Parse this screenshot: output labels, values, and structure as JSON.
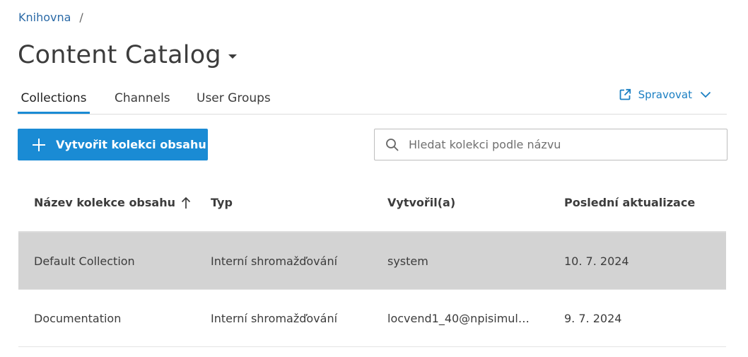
{
  "breadcrumb": {
    "link": "Knihovna",
    "separator": "/"
  },
  "page": {
    "title": "Content Catalog"
  },
  "tabs": [
    {
      "label": "Collections",
      "active": true
    },
    {
      "label": "Channels",
      "active": false
    },
    {
      "label": "User Groups",
      "active": false
    }
  ],
  "manage": {
    "label": "Spravovat",
    "icon": "external-link-icon"
  },
  "create_button": {
    "label": "Vytvořit kolekci obsahu",
    "icon": "plus-icon"
  },
  "search": {
    "placeholder": "Hledat kolekci podle názvu",
    "value": ""
  },
  "table": {
    "columns": [
      "Název kolekce obsahu",
      "Typ",
      "Vytvořil(a)",
      "Poslední aktualizace"
    ],
    "sort_icon": "arrow-up-icon",
    "rows": [
      {
        "name": "Default Collection",
        "type": "Interní shromažďování",
        "created_by": "system",
        "updated": "10. 7. 2024",
        "selected": true
      },
      {
        "name": "Documentation",
        "type": "Interní shromažďování",
        "created_by": "locvend1_40@npisimul…",
        "updated": "9. 7. 2024",
        "selected": false
      }
    ]
  },
  "colors": {
    "accent": "#1a8bd4",
    "link": "#2b6aa7",
    "selected_row": "#d3d3d3"
  }
}
